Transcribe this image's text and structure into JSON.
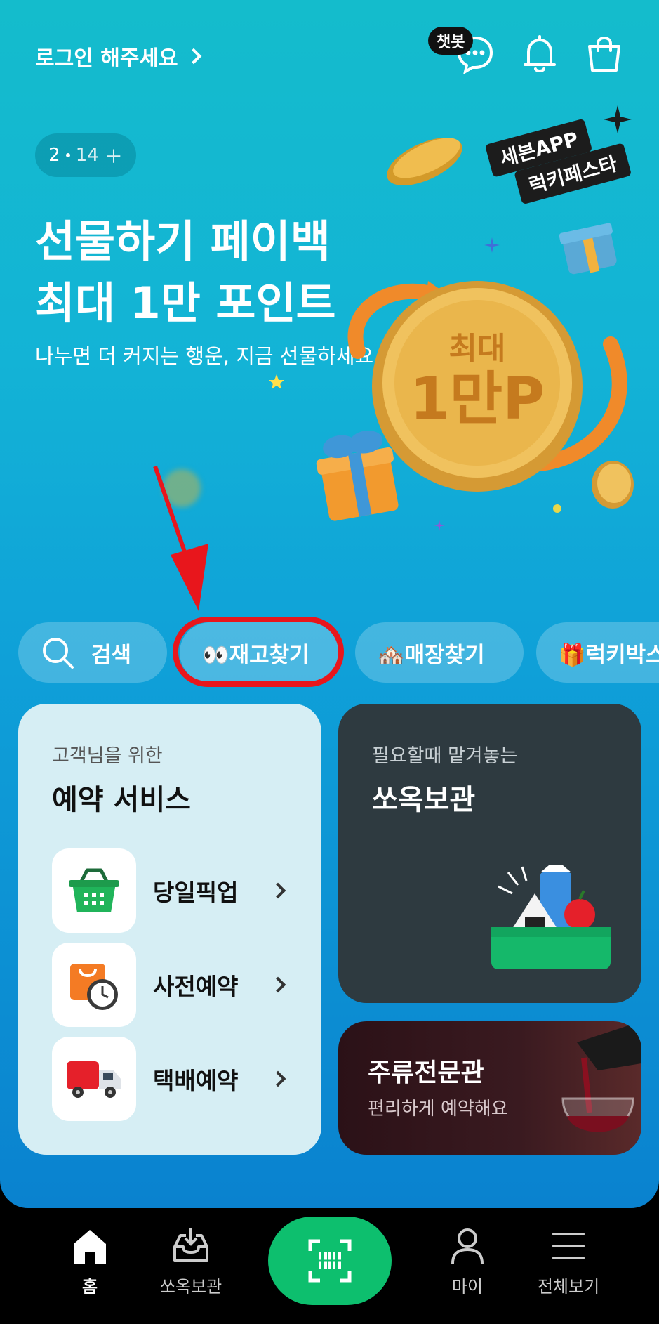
{
  "header": {
    "login_label": "로그인 해주세요",
    "chatbot_label": "챗봇"
  },
  "banner": {
    "page_current": "2",
    "page_total": "14",
    "title_line1": "선물하기 페이백",
    "title_line2": "최대 1만 포인트",
    "subtitle": "나누면 더 커지는 행운, 지금 선물하세요",
    "badge_line1": "세븐APP",
    "badge_line2": "럭키페스타",
    "coin_line1": "최대",
    "coin_line2": "1만P"
  },
  "chips": [
    {
      "label": "검색",
      "icon": "search-icon"
    },
    {
      "label": "👀재고찾기",
      "icon": "eyes-emoji"
    },
    {
      "label": "🏘️매장찾기",
      "icon": "houses-emoji"
    },
    {
      "label": "🎁럭키박스",
      "icon": "gift-emoji"
    }
  ],
  "reservation_card": {
    "caption": "고객님을 위한",
    "title": "예약 서비스",
    "items": [
      {
        "label": "당일픽업",
        "icon": "basket-icon"
      },
      {
        "label": "사전예약",
        "icon": "shopping-bag-clock-icon"
      },
      {
        "label": "택배예약",
        "icon": "delivery-truck-icon"
      }
    ]
  },
  "storage_card": {
    "caption": "필요할때 맡겨놓는",
    "title": "쏘옥보관"
  },
  "liquor_card": {
    "title": "주류전문관",
    "caption": "편리하게 예약해요"
  },
  "bottom_nav": {
    "home": "홈",
    "storage": "쏘옥보관",
    "my": "마이",
    "all": "전체보기"
  },
  "colors": {
    "accent_green": "#0dbf6e",
    "highlight_red": "#e8161c",
    "banner_top": "#14bccc",
    "banner_bottom": "#0a82cf"
  }
}
